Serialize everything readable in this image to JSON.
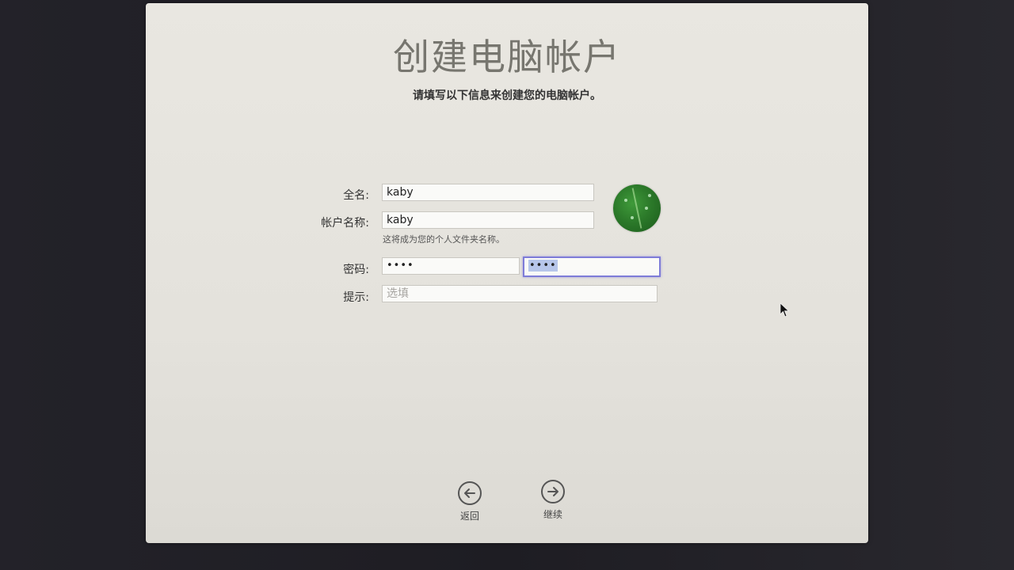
{
  "header": {
    "title": "创建电脑帐户",
    "subtitle": "请填写以下信息来创建您的电脑帐户。"
  },
  "form": {
    "full_name_label": "全名:",
    "full_name_value": "kaby",
    "account_name_label": "帐户名称:",
    "account_name_value": "kaby",
    "account_name_hint": "这将成为您的个人文件夹名称。",
    "password_label": "密码:",
    "password_value": "••••",
    "password_verify_value": "••••",
    "hint_label": "提示:",
    "hint_placeholder": "选填"
  },
  "avatar": {
    "icon": "leaf-avatar-icon"
  },
  "nav": {
    "back_label": "返回",
    "continue_label": "继续"
  },
  "colors": {
    "panel_bg": "#e6e4de",
    "focus_ring": "#7e7cd8",
    "avatar_green": "#2c7a2a"
  }
}
